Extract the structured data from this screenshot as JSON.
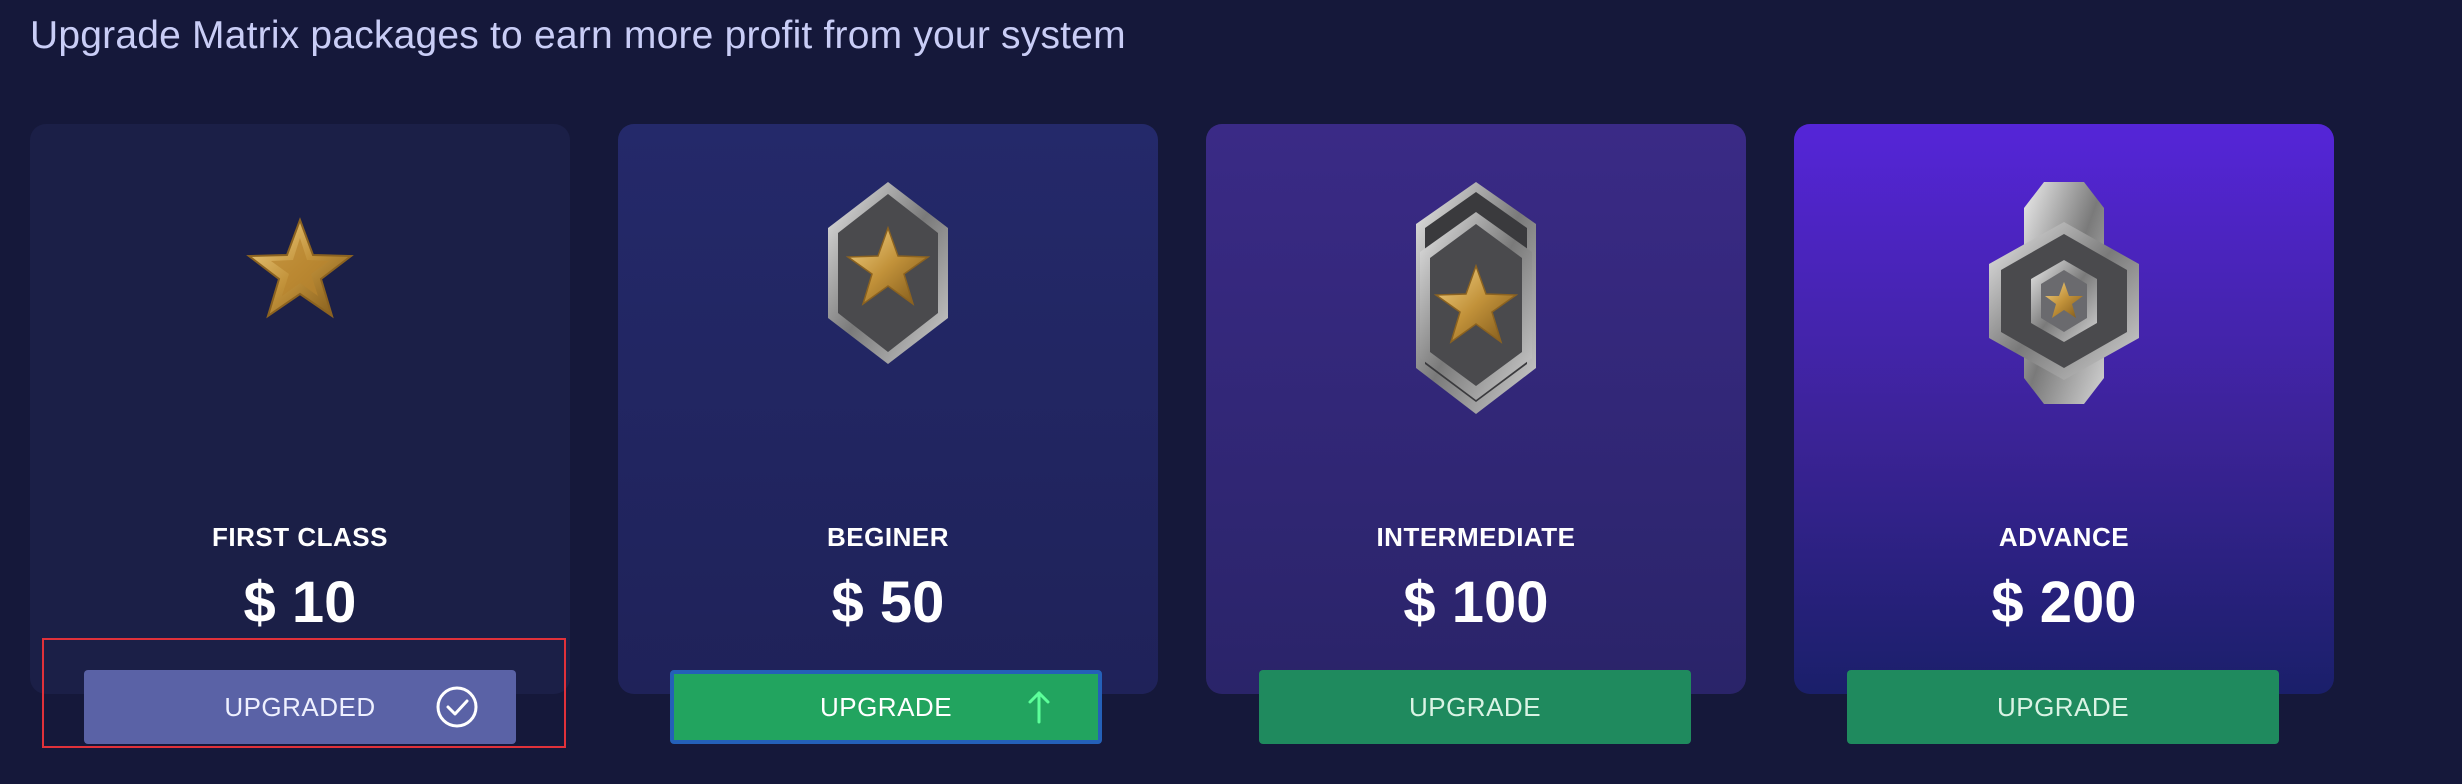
{
  "header": {
    "title": "Upgrade Matrix packages to earn more profit from your system"
  },
  "packages": [
    {
      "name": "FIRST CLASS",
      "price": "$ 10",
      "button_label": "UPGRADED",
      "button_icon": "check-circle-icon",
      "status": "upgraded"
    },
    {
      "name": "BEGINER",
      "price": "$ 50",
      "button_label": "UPGRADE",
      "button_icon": "arrow-up-icon",
      "status": "available"
    },
    {
      "name": "INTERMEDIATE",
      "price": "$ 100",
      "button_label": "UPGRADE",
      "status": "available"
    },
    {
      "name": "ADVANCE",
      "price": "$ 200",
      "button_label": "UPGRADE",
      "status": "available"
    }
  ],
  "colors": {
    "background": "#15183a",
    "upgraded_button": "#5a62a6",
    "upgrade_button": "#1f8a5e",
    "active_upgrade_button": "#22a45f",
    "focus_border": "#2460b8",
    "highlight_box": "#e0313a",
    "star_gold": "#c99a3c"
  }
}
